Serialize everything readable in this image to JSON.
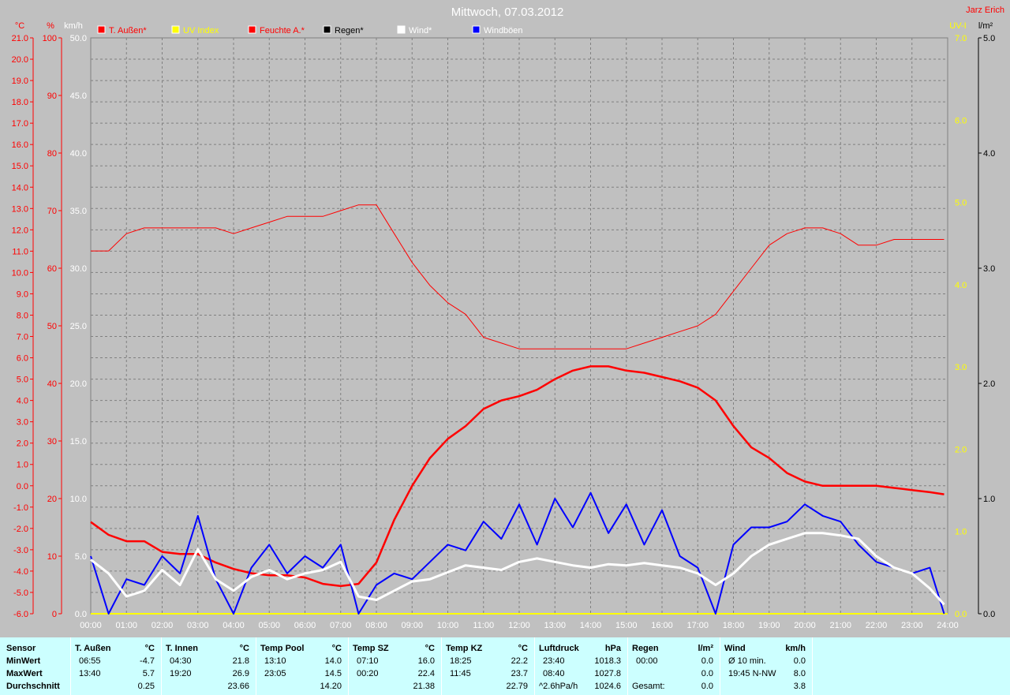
{
  "header": {
    "title": "Mittwoch, 07.03.2012",
    "author": "Jarz Erich"
  },
  "legend": [
    {
      "label": "T. Außen*",
      "color": "#ff0000",
      "text_color": "#ff0000"
    },
    {
      "label": "UV Index",
      "color": "#ffff00",
      "text_color": "#ffff00"
    },
    {
      "label": "Feuchte A.*",
      "color": "#ff0000",
      "text_color": "#ff0000"
    },
    {
      "label": "Regen*",
      "color": "#000000",
      "text_color": "#000000"
    },
    {
      "label": "Wind*",
      "color": "#ffffff",
      "text_color": "#ffffff"
    },
    {
      "label": "Windböen",
      "color": "#0000ff",
      "text_color": "#ffffff"
    }
  ],
  "axes": {
    "temp": {
      "unit": "°C",
      "ticks": [
        "21.0",
        "20.0",
        "19.0",
        "18.0",
        "17.0",
        "16.0",
        "15.0",
        "14.0",
        "13.0",
        "12.0",
        "11.0",
        "10.0",
        "9.0",
        "8.0",
        "7.0",
        "6.0",
        "5.0",
        "4.0",
        "3.0",
        "2.0",
        "1.0",
        "0.0",
        "-1.0",
        "-2.0",
        "-3.0",
        "-4.0",
        "-5.0",
        "-6.0"
      ]
    },
    "humidity": {
      "unit": "%",
      "ticks": [
        "100",
        "90",
        "80",
        "70",
        "60",
        "50",
        "40",
        "30",
        "20",
        "10",
        "0"
      ]
    },
    "wind": {
      "unit": "km/h",
      "ticks": [
        "50.0",
        "45.0",
        "40.0",
        "35.0",
        "30.0",
        "25.0",
        "20.0",
        "15.0",
        "10.0",
        "5.0",
        "0.0"
      ]
    },
    "uv": {
      "unit": "UV-I",
      "ticks": [
        "7.0",
        "6.0",
        "5.0",
        "4.0",
        "3.0",
        "2.0",
        "1.0",
        "0.0"
      ]
    },
    "rain": {
      "unit": "l/m²",
      "ticks": [
        "5.0",
        "4.0",
        "3.0",
        "2.0",
        "1.0",
        "0.0"
      ]
    },
    "time": {
      "ticks": [
        "00:00",
        "01:00",
        "02:00",
        "03:00",
        "04:00",
        "05:00",
        "06:00",
        "07:00",
        "08:00",
        "09:00",
        "10:00",
        "11:00",
        "12:00",
        "13:00",
        "14:00",
        "15:00",
        "16:00",
        "17:00",
        "18:00",
        "19:00",
        "20:00",
        "21:00",
        "22:00",
        "23:00",
        "24:00"
      ]
    }
  },
  "colors": {
    "background": "#c0c0c0",
    "grid": "#808080",
    "temp": "#ff0000",
    "humidity": "#ff0000",
    "wind": "#ffffff",
    "gusts": "#0000ff",
    "uv": "#ffff00",
    "table_bg": "#ccffff"
  },
  "chart_data": {
    "type": "line",
    "title": "Mittwoch, 07.03.2012",
    "x_unit": "hours",
    "x_range": [
      0,
      24
    ],
    "grid": true,
    "series": [
      {
        "name": "T. Außen*",
        "axis": "°C",
        "ylim": [
          -6,
          21
        ],
        "x": [
          0,
          0.5,
          1,
          1.5,
          2,
          2.5,
          3,
          3.5,
          4,
          4.5,
          5,
          5.5,
          6,
          6.5,
          7,
          7.5,
          8,
          8.5,
          9,
          9.5,
          10,
          10.5,
          11,
          11.5,
          12,
          12.5,
          13,
          13.5,
          14,
          14.5,
          15,
          15.5,
          16,
          16.5,
          17,
          17.5,
          18,
          18.5,
          19,
          19.5,
          20,
          20.5,
          21,
          21.5,
          22,
          22.5,
          23,
          23.5,
          23.9
        ],
        "y": [
          -1.7,
          -2.3,
          -2.6,
          -2.6,
          -3.1,
          -3.2,
          -3.2,
          -3.6,
          -3.9,
          -4.1,
          -4.2,
          -4.2,
          -4.3,
          -4.6,
          -4.7,
          -4.6,
          -3.6,
          -1.6,
          0.0,
          1.3,
          2.2,
          2.8,
          3.6,
          4.0,
          4.2,
          4.5,
          5.0,
          5.4,
          5.6,
          5.6,
          5.4,
          5.3,
          5.1,
          4.9,
          4.6,
          4.0,
          2.8,
          1.8,
          1.3,
          0.6,
          0.2,
          0.0,
          0.0,
          0.0,
          0.0,
          -0.1,
          -0.2,
          -0.3,
          -0.4
        ]
      },
      {
        "name": "Feuchte A.*",
        "axis": "%",
        "ylim": [
          0,
          100
        ],
        "x": [
          0,
          0.5,
          1,
          1.5,
          2,
          2.5,
          3,
          3.5,
          4,
          4.5,
          5,
          5.5,
          6,
          6.5,
          7,
          7.5,
          8,
          8.5,
          9,
          9.5,
          10,
          10.5,
          11,
          11.5,
          12,
          12.5,
          13,
          13.5,
          14,
          14.5,
          15,
          15.5,
          16,
          16.5,
          17,
          17.5,
          18,
          18.5,
          19,
          19.5,
          20,
          20.5,
          21,
          21.5,
          22,
          22.5,
          23,
          23.5,
          23.9
        ],
        "y": [
          63,
          63,
          66,
          67,
          67,
          67,
          67,
          67,
          66,
          67,
          68,
          69,
          69,
          69,
          70,
          71,
          71,
          66,
          61,
          57,
          54,
          52,
          48,
          47,
          46,
          46,
          46,
          46,
          46,
          46,
          46,
          47,
          48,
          49,
          50,
          52,
          56,
          60,
          64,
          66,
          67,
          67,
          66,
          64,
          64,
          65,
          65,
          65,
          65
        ]
      },
      {
        "name": "Wind*",
        "axis": "km/h",
        "ylim": [
          0,
          50
        ],
        "x": [
          0,
          0.5,
          1,
          1.5,
          2,
          2.5,
          3,
          3.5,
          4,
          4.5,
          5,
          5.5,
          6,
          6.5,
          7,
          7.5,
          8,
          8.5,
          9,
          9.5,
          10,
          10.5,
          11,
          11.5,
          12,
          12.5,
          13,
          13.5,
          14,
          14.5,
          15,
          15.5,
          16,
          16.5,
          17,
          17.5,
          18,
          18.5,
          19,
          19.5,
          20,
          20.5,
          21,
          21.5,
          22,
          22.5,
          23,
          23.5,
          23.9
        ],
        "y": [
          4.7,
          3.5,
          1.5,
          2.0,
          3.8,
          2.5,
          5.6,
          3.0,
          2.0,
          3.2,
          3.8,
          3.0,
          3.5,
          3.8,
          4.5,
          1.5,
          1.2,
          2.0,
          2.8,
          3.0,
          3.6,
          4.2,
          4.0,
          3.8,
          4.5,
          4.8,
          4.5,
          4.2,
          4.0,
          4.3,
          4.2,
          4.4,
          4.2,
          4.0,
          3.5,
          2.5,
          3.5,
          5.0,
          6.0,
          6.5,
          7.0,
          7.0,
          6.8,
          6.5,
          5.0,
          4.0,
          3.5,
          2.2,
          0.8
        ]
      },
      {
        "name": "Windböen",
        "axis": "km/h",
        "ylim": [
          0,
          50
        ],
        "x": [
          0,
          0.5,
          1,
          1.5,
          2,
          2.5,
          3,
          3.5,
          4,
          4.5,
          5,
          5.5,
          6,
          6.5,
          7,
          7.5,
          8,
          8.5,
          9,
          9.5,
          10,
          10.5,
          11,
          11.5,
          12,
          12.5,
          13,
          13.5,
          14,
          14.5,
          15,
          15.5,
          16,
          16.5,
          17,
          17.5,
          18,
          18.5,
          19,
          19.5,
          20,
          20.5,
          21,
          21.5,
          22,
          22.5,
          23,
          23.5,
          23.9
        ],
        "y": [
          5.0,
          0.0,
          3.0,
          2.5,
          5.0,
          3.5,
          8.5,
          3.0,
          0.0,
          4.0,
          6.0,
          3.5,
          5.0,
          4.0,
          6.0,
          0.0,
          2.5,
          3.5,
          3.0,
          4.5,
          6.0,
          5.5,
          8.0,
          6.5,
          9.5,
          6.0,
          10.0,
          7.5,
          10.5,
          7.0,
          9.5,
          6.0,
          9.0,
          5.0,
          4.0,
          0.0,
          6.0,
          7.5,
          7.5,
          8.0,
          9.5,
          8.5,
          8.0,
          6.0,
          4.5,
          4.0,
          3.5,
          4.0,
          0.0
        ]
      },
      {
        "name": "UV Index",
        "axis": "UV-I",
        "ylim": [
          0,
          7
        ],
        "x": [
          0,
          24
        ],
        "y": [
          0,
          0
        ]
      },
      {
        "name": "Regen*",
        "axis": "l/m²",
        "ylim": [
          0,
          5
        ],
        "x": [
          0,
          24
        ],
        "y": [
          0,
          0
        ]
      }
    ]
  },
  "table": {
    "row_labels": {
      "header": "Sensor",
      "min": "MinWert",
      "max": "MaxWert",
      "avg": "Durchschnitt"
    },
    "columns": [
      {
        "name": "T. Außen",
        "unit": "°C",
        "min": [
          "06:55",
          "-4.7"
        ],
        "max": [
          "13:40",
          "5.7"
        ],
        "avg": [
          "",
          "0.25"
        ]
      },
      {
        "name": "T. Innen",
        "unit": "°C",
        "min": [
          "04:30",
          "21.8"
        ],
        "max": [
          "19:20",
          "26.9"
        ],
        "avg": [
          "",
          "23.66"
        ]
      },
      {
        "name": "Temp Pool",
        "unit": "°C",
        "min": [
          "13:10",
          "14.0"
        ],
        "max": [
          "23:05",
          "14.5"
        ],
        "avg": [
          "",
          "14.20"
        ]
      },
      {
        "name": "Temp SZ",
        "unit": "°C",
        "min": [
          "07:10",
          "16.0"
        ],
        "max": [
          "00:20",
          "22.4"
        ],
        "avg": [
          "",
          "21.38"
        ]
      },
      {
        "name": "Temp KZ",
        "unit": "°C",
        "min": [
          "18:25",
          "22.2"
        ],
        "max": [
          "11:45",
          "23.7"
        ],
        "avg": [
          "",
          "22.79"
        ]
      },
      {
        "name": "Luftdruck",
        "unit": "hPa",
        "min": [
          "23:40",
          "1018.3"
        ],
        "max": [
          "08:40",
          "1027.8"
        ],
        "avg": [
          "^2.6hPa/h",
          "1024.6"
        ]
      },
      {
        "name": "Regen",
        "unit": "l/m²",
        "min": [
          "00:00",
          "0.0"
        ],
        "max": [
          "",
          "0.0"
        ],
        "avg": [
          "Gesamt:",
          "0.0"
        ]
      },
      {
        "name": "Wind",
        "unit": "km/h",
        "min": [
          "Ø 10 min.",
          "0.0"
        ],
        "max": [
          "19:45   N-NW",
          "8.0"
        ],
        "avg": [
          "",
          "3.8"
        ]
      }
    ]
  }
}
